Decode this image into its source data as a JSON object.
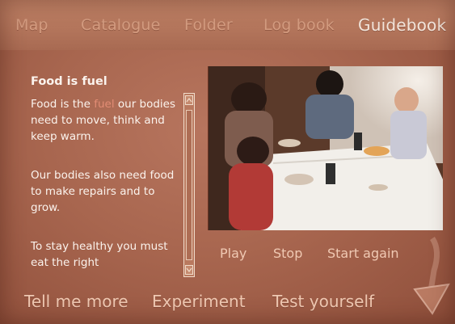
{
  "nav": {
    "items": [
      {
        "label": "Map",
        "active": false
      },
      {
        "label": "Catalogue",
        "active": false
      },
      {
        "label": "Folder",
        "active": false
      },
      {
        "label": "Log book",
        "active": false
      },
      {
        "label": "Guidebook",
        "active": true
      }
    ]
  },
  "content": {
    "heading": "Food is fuel",
    "para1_start": "Food is the",
    "para1_highlight": "fuel",
    "para1_end": "our bodies need to move, think and keep warm.",
    "para2": "Our bodies also need food to make repairs and to grow.",
    "para3": "To stay healthy you must eat the right"
  },
  "video": {
    "play": "Play",
    "stop": "Stop",
    "restart": "Start again"
  },
  "actions": {
    "tell_more": "Tell me more",
    "experiment": "Experiment",
    "test": "Test yourself"
  },
  "colors": {
    "background": "#a8664f",
    "text": "#fbf3ed",
    "inactive_nav": "#d49c80"
  }
}
